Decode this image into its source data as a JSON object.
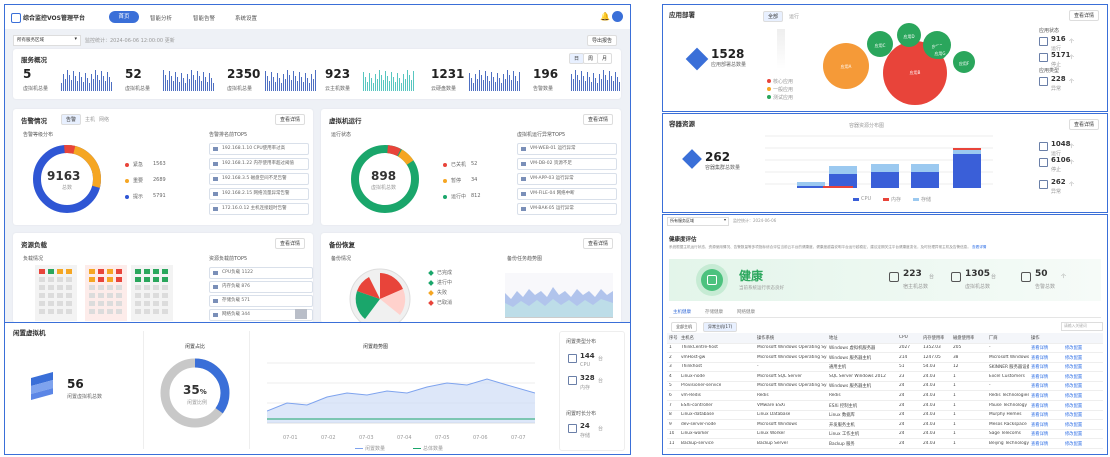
{
  "app": {
    "title": "综合监控VOS管理平台",
    "nav": [
      "首页",
      "智能分析",
      "智能告警",
      "系统设置"
    ]
  },
  "filter": {
    "select": "所有服务区域",
    "text": "监控统计：2024-06-06 12:00:00 更新",
    "export": "导出报告"
  },
  "summary": {
    "title": "服务概况",
    "mode": [
      "日",
      "周",
      "月"
    ],
    "stats": [
      {
        "value": "5",
        "label": "虚拟机总量"
      },
      {
        "value": "52",
        "label": "虚拟机总量"
      },
      {
        "value": "2350",
        "label": "虚拟机总量"
      },
      {
        "value": "923",
        "label": "云主机数量"
      },
      {
        "value": "1231",
        "label": "云硬盘数量"
      },
      {
        "value": "196",
        "label": "告警数量"
      }
    ]
  },
  "panel1": {
    "title": "告警情况",
    "tabs": [
      "告警",
      "主机",
      "网络"
    ],
    "sub": "告警等级分布",
    "list_title": "告警排名前TOP5",
    "btn": "查看详情",
    "center_value": "9163",
    "center_label": "总数",
    "legend": [
      {
        "label": "紧急",
        "value": "1563",
        "color": "#e8443a"
      },
      {
        "label": "重要",
        "value": "2689",
        "color": "#f5a623"
      },
      {
        "label": "提示",
        "value": "5791",
        "color": "#2f56d4"
      }
    ],
    "list": [
      "192.168.1.10 CPU使用率过高",
      "192.168.1.22 内存使用率超过阈值",
      "192.168.3.5 磁盘空间不足告警",
      "192.168.2.15 网络流量异常告警",
      "172.16.0.12 主机连接超时告警"
    ]
  },
  "panel2": {
    "title": "虚拟机运行",
    "sub": "运行状态",
    "list_title": "虚拟机运行异常TOP5",
    "btn": "查看详情",
    "center_value": "898",
    "center_label": "虚拟机总数",
    "legend": [
      {
        "label": "已关机",
        "value": "52",
        "color": "#e8443a"
      },
      {
        "label": "暂停",
        "value": "34",
        "color": "#f5a623"
      },
      {
        "label": "运行中",
        "value": "812",
        "color": "#1aa66b"
      }
    ],
    "list": [
      "VM-WEB-01 运行异常",
      "VM-DB-02 资源不足",
      "VM-APP-03 运行异常",
      "VM-FILE-04 网络中断",
      "VM-BAK-05 运行异常"
    ]
  },
  "panel3": {
    "title": "资源负载",
    "sub": "负载情况",
    "list_title": "资源负载前TOP5",
    "btn": "查看详情",
    "list": [
      "CPU负载 1122",
      "内存负载 876",
      "存储负载 571",
      "网络负载 344"
    ]
  },
  "panel4": {
    "title": "备份恢复",
    "sub": "备份情况",
    "chart_title": "备份任务趋势图",
    "btn": "查看详情",
    "legend": [
      "已完成",
      "进行中",
      "失败",
      "已取消"
    ]
  },
  "vmcard": {
    "title": "闲置虚拟机",
    "value": "56",
    "label": "闲置虚拟机总数",
    "donut_title": "闲置占比",
    "percent": "35",
    "percent_unit": "%",
    "percent_label": "闲置比例",
    "chart_title": "闲置趋势图",
    "dates": [
      "07-01",
      "07-02",
      "07-03",
      "07-04",
      "07-05",
      "07-06",
      "07-07"
    ],
    "legend": [
      "闲置数量",
      "总体数量"
    ],
    "side_title1": "闲置类型分布",
    "side_title2": "闲置时长分布",
    "side": [
      {
        "value": "144",
        "unit": "台",
        "label": "CPU"
      },
      {
        "value": "328",
        "unit": "台",
        "label": "内存"
      },
      {
        "value": "24",
        "unit": "台",
        "label": "存储"
      }
    ]
  },
  "rtop": {
    "title": "应用部署",
    "tabs": [
      "全部",
      "运行"
    ],
    "value": "1528",
    "label": "应用部署总数量",
    "btn": "查看详情",
    "bubbles": [
      "应用A",
      "应用B",
      "应用C",
      "应用D",
      "应用E",
      "应用F",
      "应用G"
    ],
    "legend": [
      "核心应用",
      "一般应用",
      "测试应用"
    ],
    "side_title1": "应用状态",
    "side_title2": "应用类型",
    "side": [
      {
        "value": "916",
        "unit": "个",
        "label": "运行"
      },
      {
        "value": "5171",
        "unit": "个",
        "label": "停止"
      },
      {
        "value": "228",
        "unit": "个",
        "label": "异常"
      }
    ]
  },
  "rmid": {
    "title": "容器资源",
    "value": "262",
    "label": "容器集群总数量",
    "btn": "查看详情",
    "chart_title": "容器资源分布图",
    "legend": [
      "CPU",
      "内存",
      "存储"
    ],
    "side": [
      {
        "value": "1048",
        "unit": "个",
        "label": "运行"
      },
      {
        "value": "6106",
        "unit": "个",
        "label": "停止"
      },
      {
        "value": "262",
        "unit": "个",
        "label": "异常"
      }
    ]
  },
  "health": {
    "filter": "所有服务区域",
    "filter2": "监控统计：2024-06-06",
    "title": "健康度评估",
    "desc": "系统根据主机运行状态、资源使用情况、告警数量等多项指标综合评估当前云平台的健康度，健康度越高说明平台运行越稳定，建议定期关注平台健康度变化，及时处理异常主机及告警信息。",
    "more": "查看详情",
    "status": "健康",
    "status_desc": "当前系统运行状态良好",
    "stats": [
      {
        "value": "223",
        "unit": "台",
        "label": "宿主机总数"
      },
      {
        "value": "1305",
        "unit": "台",
        "label": "虚拟机总数"
      },
      {
        "value": "50",
        "unit": "个",
        "label": "告警总数"
      }
    ],
    "tabs": [
      "主机健康",
      "存储健康",
      "网络健康"
    ],
    "subtabs": [
      "全部主机",
      "异常主机(17)"
    ],
    "search": "请输入关键词",
    "cols": [
      "序号",
      "主机名",
      "操作系统",
      "地址",
      "CPU",
      "内存使用率",
      "磁盘使用率",
      "厂商",
      "操作",
      ""
    ],
    "rows": [
      [
        "1",
        "ThinkCentre-host",
        "Microsoft Windows Operating System",
        "Windows 虚拟机服务器",
        "2027",
        "1352.03",
        "205",
        "-",
        "查看详情",
        "修改配置"
      ],
      [
        "2",
        "vmHost-gw",
        "Microsoft Windows Operating System",
        "Windows 服务器主机",
        "214",
        "1247.05",
        "38",
        "Microsoft Windows",
        "查看详情",
        "修改配置"
      ],
      [
        "3",
        "Thinkhost",
        "-",
        "通用主机",
        "51",
        "54.03",
        "12",
        "SKINNER 服务器设备",
        "查看详情",
        "修改配置"
      ],
      [
        "4",
        "Linux-node",
        "Microsoft SQL Server",
        "SQL Server Windows 2012",
        "23",
        "24.03",
        "1",
        "Excel Customers",
        "查看详情",
        "修改配置"
      ],
      [
        "5",
        "Provisioner-service",
        "Microsoft Windows Operating System",
        "Windows 服务器主机",
        "24",
        "24.03",
        "1",
        "-",
        "查看详情",
        "修改配置"
      ],
      [
        "6",
        "vm-Redis",
        "Redis",
        "Redis",
        "24",
        "24.03",
        "1",
        "Redis Technologies",
        "查看详情",
        "修改配置"
      ],
      [
        "7",
        "ESXi-controller",
        "VMware ESXi",
        "ESXi 控制主机",
        "24",
        "24.03",
        "1",
        "Pause Technology",
        "查看详情",
        "修改配置"
      ],
      [
        "8",
        "Linux-database",
        "Linux Database",
        "Linux 数据库",
        "24",
        "24.03",
        "1",
        "Murphy Hemes",
        "查看详情",
        "修改配置"
      ],
      [
        "9",
        "dev-server-node",
        "Microsoft Windows",
        "开发服务主机",
        "24",
        "24.03",
        "1",
        "Mesos Rackspace",
        "查看详情",
        "修改配置"
      ],
      [
        "10",
        "Linux-worker",
        "Linux Worker",
        "Linux 工作主机",
        "24",
        "24.03",
        "1",
        "Sage Telecoms",
        "查看详情",
        "修改配置"
      ],
      [
        "11",
        "Backup-service",
        "Backup Server",
        "Backup 服务",
        "24",
        "24.03",
        "1",
        "Beijing Technology",
        "查看详情",
        "修改配置"
      ]
    ]
  }
}
